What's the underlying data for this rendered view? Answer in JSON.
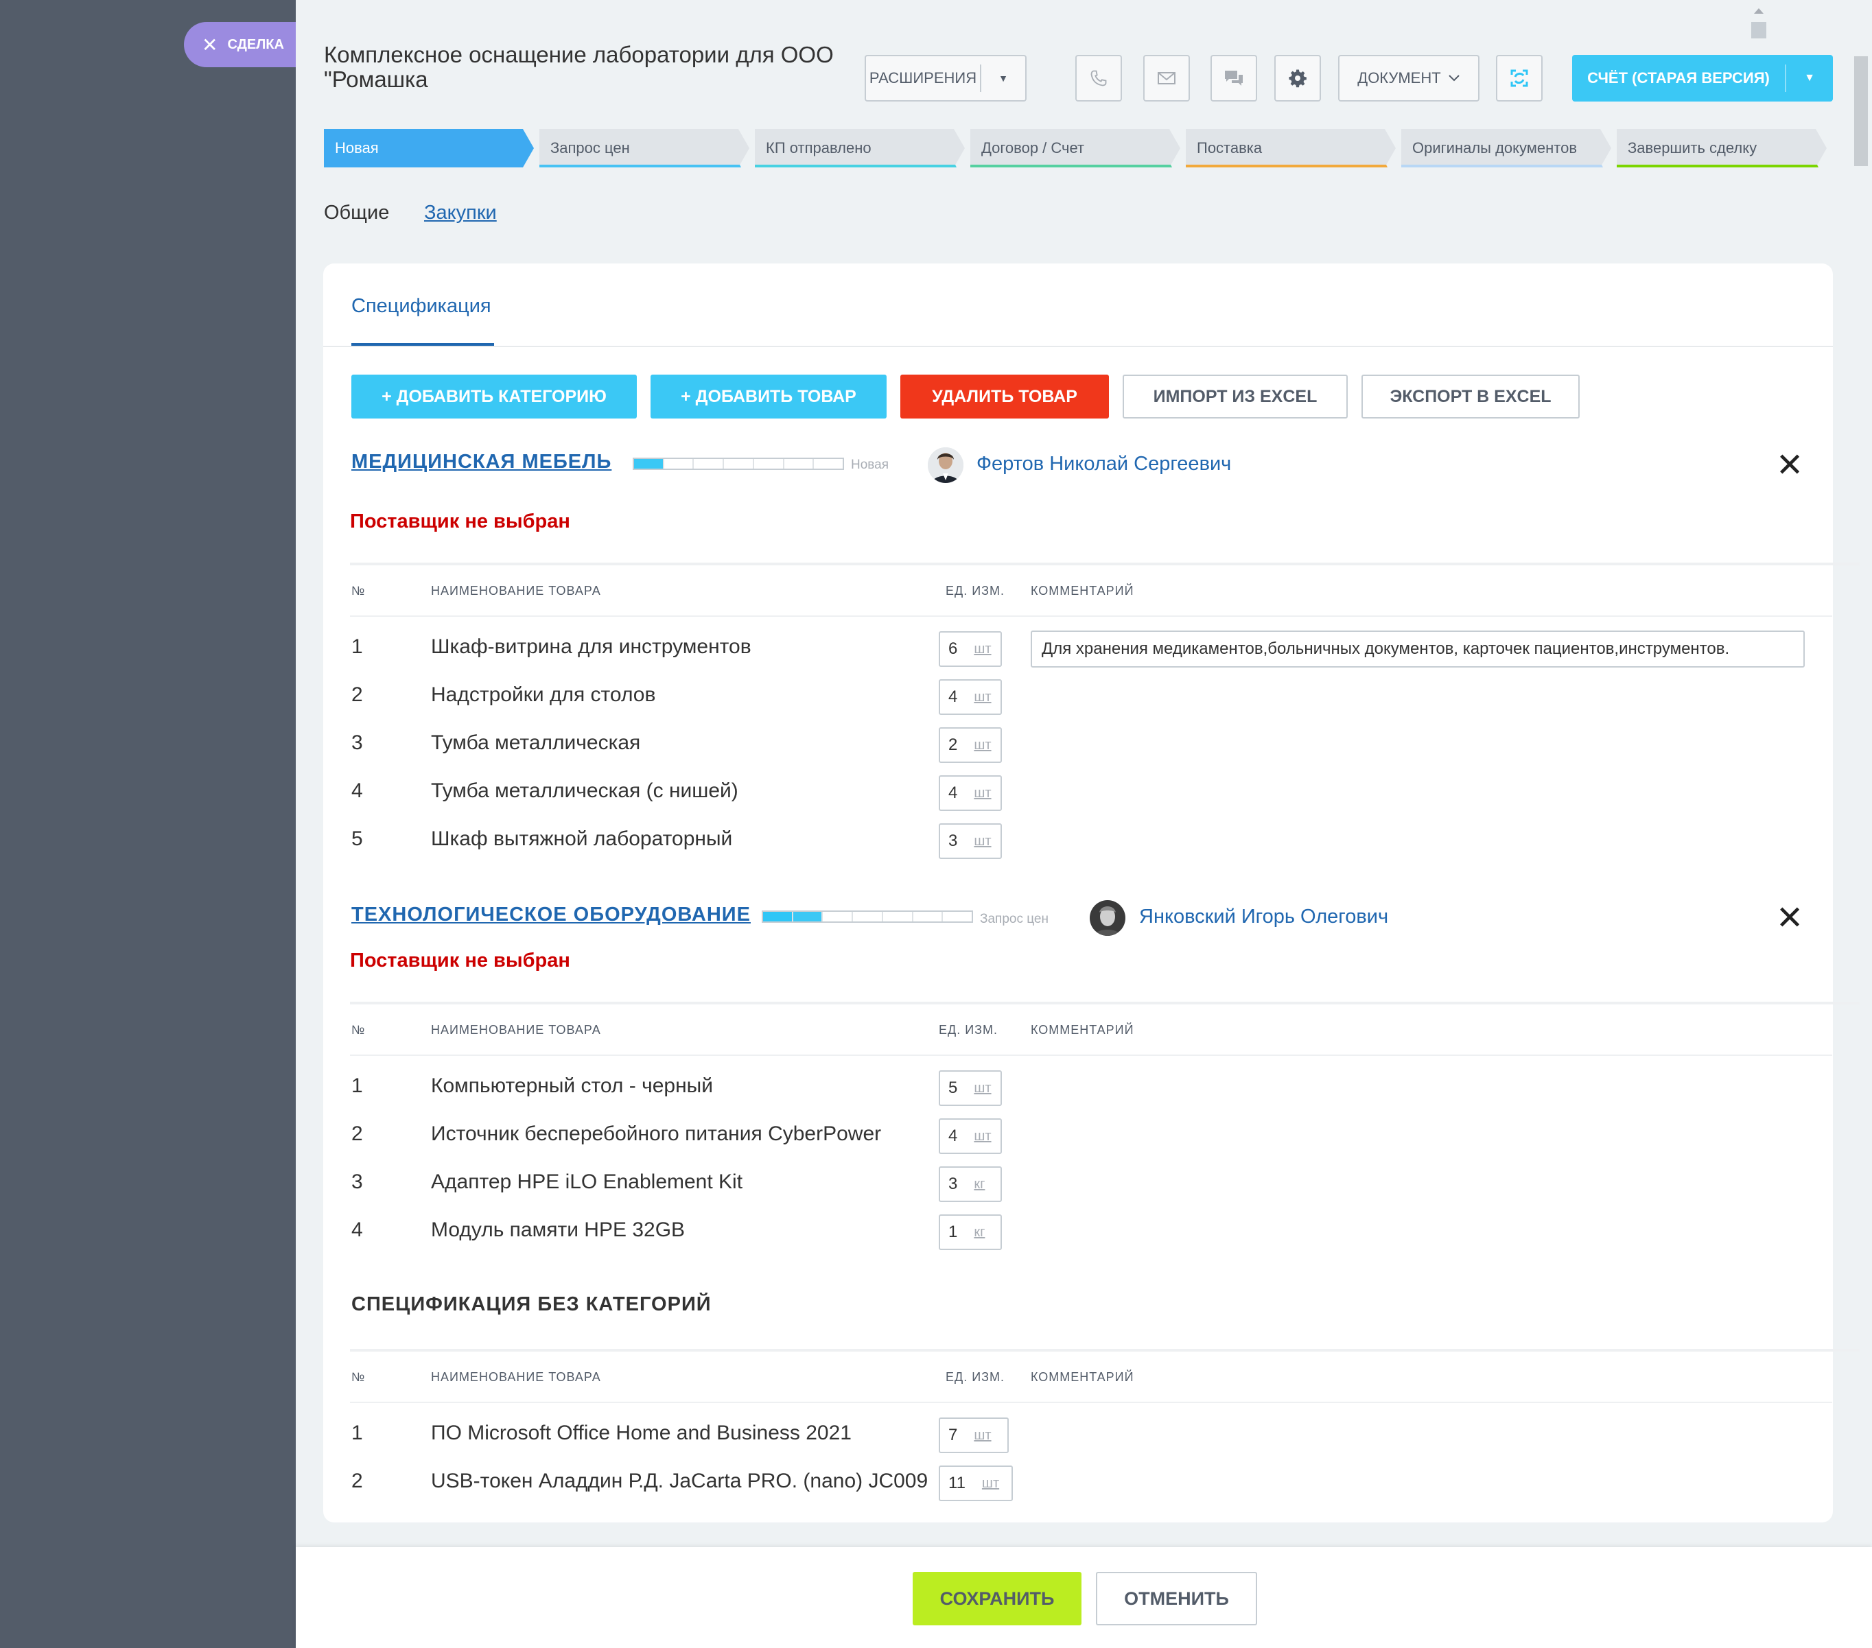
{
  "sidebar": {
    "deal_tab": "СДЕЛКА"
  },
  "header": {
    "title": "Комплексное оснащение лаборатории для ООО \"Ромашка",
    "extensions_label": "РАСШИРЕНИЯ",
    "document_label": "ДОКУМЕНТ",
    "account_label": "СЧЁТ (СТАРАЯ ВЕРСИЯ)"
  },
  "stages": [
    {
      "label": "Новая",
      "color": "#3eaaf1"
    },
    {
      "label": "Запрос цен",
      "color": "#47c2f3"
    },
    {
      "label": "КП отправлено",
      "color": "#47d1e2"
    },
    {
      "label": "Договор / Счет",
      "color": "#55d0a0"
    },
    {
      "label": "Поставка",
      "color": "#f2a93b"
    },
    {
      "label": "Оригиналы документов",
      "color": "#b8d7f5"
    },
    {
      "label": "Завершить сделку",
      "color": "#7bd500"
    }
  ],
  "tabs": {
    "general": "Общие",
    "purchases": "Закупки"
  },
  "spec": {
    "tab_label": "Спецификация",
    "add_category": "+ ДОБАВИТЬ КАТЕГОРИЮ",
    "add_product": "+ ДОБАВИТЬ ТОВАР",
    "delete_product": "УДАЛИТЬ ТОВАР",
    "import_excel": "ИМПОРТ ИЗ EXCEL",
    "export_excel": "ЭКСПОРТ В EXCEL",
    "columns": {
      "num": "№",
      "name": "НАИМЕНОВАНИЕ ТОВАРА",
      "unit": "ЕД. ИЗМ.",
      "comment": "КОММЕНТАРИЙ"
    }
  },
  "categories": [
    {
      "title": "МЕДИЦИНСКАЯ МЕБЕЛЬ",
      "stage_label": "Новая",
      "progress_steps_done": 1,
      "progress_steps_total": 7,
      "person": "Фертов Николай Сергеевич",
      "supplier": "Поставщик не выбран",
      "comment": "Для хранения медикаментов,больничных документов, карточек пациентов,инструментов.",
      "items": [
        {
          "num": "1",
          "name": "Шкаф-витрина для инструментов",
          "qty": "6",
          "unit": "шт"
        },
        {
          "num": "2",
          "name": "Надстройки для столов",
          "qty": "4",
          "unit": "шт"
        },
        {
          "num": "3",
          "name": "Тумба металлическая",
          "qty": "2",
          "unit": "шт"
        },
        {
          "num": "4",
          "name": "Тумба металлическая (с нишей)",
          "qty": "4",
          "unit": "шт"
        },
        {
          "num": "5",
          "name": "Шкаф вытяжной лабораторный",
          "qty": "3",
          "unit": "шт"
        }
      ]
    },
    {
      "title": "ТЕХНОЛОГИЧЕСКОЕ ОБОРУДОВАНИЕ",
      "stage_label": "Запрос цен",
      "progress_steps_done": 2,
      "progress_steps_total": 7,
      "person": "Янковский Игорь Олегович",
      "supplier": "Поставщик не выбран",
      "items": [
        {
          "num": "1",
          "name": "Компьютерный стол - черный",
          "qty": "5",
          "unit": "шт"
        },
        {
          "num": "2",
          "name": "Источник бесперебойного питания CyberPower",
          "qty": "4",
          "unit": "шт"
        },
        {
          "num": "3",
          "name": "Адаптер HPE iLO Enablement Kit",
          "qty": "3",
          "unit": "кг"
        },
        {
          "num": "4",
          "name": "Модуль памяти HPE 32GB",
          "qty": "1",
          "unit": "кг"
        }
      ]
    }
  ],
  "no_category": {
    "title": "СПЕЦИФИКАЦИЯ БЕЗ КАТЕГОРИЙ",
    "items": [
      {
        "num": "1",
        "name": "ПО Microsoft Office Home and Business 2021",
        "qty": "7",
        "unit": "шт"
      },
      {
        "num": "2",
        "name": "USB-токен Аладдин Р.Д. JaCarta PRO. (nano) JC009",
        "qty": "11",
        "unit": "шт"
      }
    ]
  },
  "footer": {
    "save": "СОХРАНИТЬ",
    "cancel": "ОТМЕНИТЬ"
  },
  "icons": [
    "close-icon",
    "chevron-down-icon",
    "phone-icon",
    "mail-icon",
    "chat-icon",
    "gear-icon",
    "sync-icon",
    "scroll-up-icon"
  ]
}
